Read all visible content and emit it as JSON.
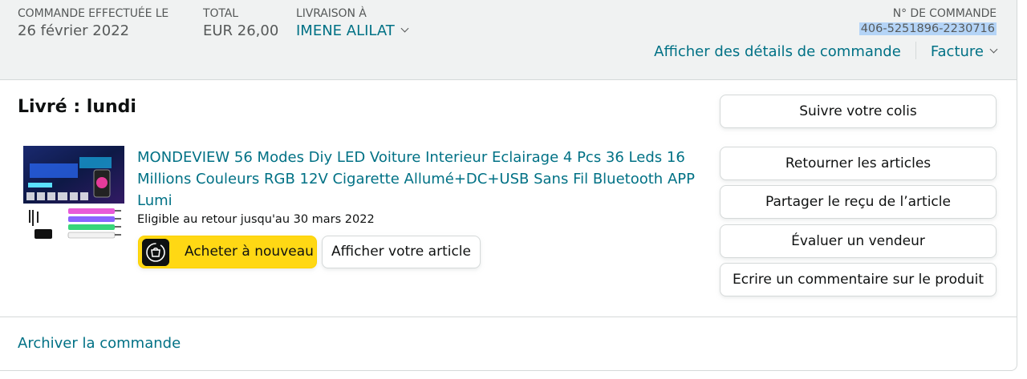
{
  "header": {
    "order_placed_label": "COMMANDE EFFECTUÉE LE",
    "order_placed_value": "26 février 2022",
    "total_label": "TOTAL",
    "total_value": "EUR 26,00",
    "ship_to_label": "LIVRAISON À",
    "ship_to_value": "IMENE ALILAT",
    "order_number_label": "N° DE COMMANDE",
    "order_number_value": "406-5251896-2230716",
    "order_details_link": "Afficher des détails de commande",
    "invoice_link": "Facture"
  },
  "shipment": {
    "status": "Livré : lundi"
  },
  "product": {
    "title": "MONDEVIEW 56 Modes Diy LED Voiture Interieur Eclairage 4 Pcs 36 Leds 16 Millions Couleurs RGB 12V Cigarette Allumé+DC+USB Sans Fil Bluetooth APP Lumi",
    "return_eligibility": "Eligible au retour jusqu'au 30 mars 2022",
    "buy_again_label": "Acheter à nouveau",
    "view_item_label": "Afficher votre article",
    "image_icon": "led-strip-product-image"
  },
  "actions": {
    "track_package": "Suivre votre colis",
    "return_items": "Retourner les articles",
    "share_receipt": "Partager le reçu de l’article",
    "rate_seller": "Évaluer un vendeur",
    "write_review": "Ecrire un commentaire sur le produit"
  },
  "footer": {
    "archive_link": "Archiver la commande"
  },
  "colors": {
    "link": "#007185",
    "header_bg": "#f0f2f2",
    "buy_again_bg": "#ffd814",
    "selection_highlight": "#b4d4f7",
    "border": "#d5d9d9"
  }
}
